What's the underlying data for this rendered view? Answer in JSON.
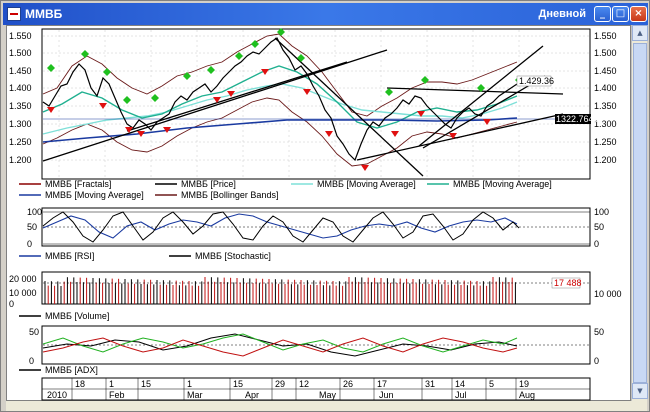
{
  "window": {
    "title": "ММВБ",
    "period": "Дневной",
    "minimize_glyph": "_",
    "maximize_glyph": "□",
    "close_glyph": "×"
  },
  "price_axis": {
    "ticks": [
      "1.550",
      "1.500",
      "1.450",
      "1.400",
      "1.350",
      "1.300",
      "1.250",
      "1.200"
    ],
    "last_price": "1.429.36",
    "ma_value": "1322.76494"
  },
  "legend_price": [
    {
      "label": "ММВБ [Fractals]",
      "color": "#8b0000"
    },
    {
      "label": "ММВБ [Price]",
      "color": "#000000"
    },
    {
      "label": "ММВБ [Moving Average]",
      "color": "#7fe0d8"
    },
    {
      "label": "ММВБ [Moving Average]",
      "color": "#20b090"
    },
    {
      "label": "ММВБ [Moving Average]",
      "color": "#1a3aa0"
    },
    {
      "label": "ММВБ [Bollinger Bands]",
      "color": "#6b1a1a"
    }
  ],
  "osc_axis": {
    "ticks": [
      "100",
      "50",
      "0"
    ]
  },
  "legend_osc": [
    {
      "label": "ММВБ [RSI]",
      "color": "#1a3aa0"
    },
    {
      "label": "ММВБ [Stochastic]",
      "color": "#000000"
    }
  ],
  "volume_axis": {
    "ticks_left": [
      "20 000",
      "10 000",
      "0"
    ],
    "ticks_right": [
      "10 000"
    ],
    "last_value": "17 488"
  },
  "legend_volume": [
    {
      "label": "ММВБ [Volume]",
      "color": "#000000"
    }
  ],
  "adx_axis": {
    "ticks": [
      "50",
      "0"
    ]
  },
  "legend_adx": [
    {
      "label": "ММВБ [ADX]",
      "color": "#000000"
    }
  ],
  "time_axis": {
    "days": [
      "18",
      "1",
      "15",
      "1",
      "15",
      "29",
      "12",
      "26",
      "17",
      "31",
      "14",
      "5",
      "19",
      "2"
    ],
    "months": [
      "2010",
      "Feb",
      "Mar",
      "Apr",
      "May",
      "Jun",
      "Jul",
      "Aug"
    ]
  },
  "colors": {
    "titlebar": "#2a62d8",
    "fractal_up": "#1fc01f",
    "fractal_down": "#e01010",
    "price": "#000000",
    "bollinger": "#6b1a1a"
  }
}
